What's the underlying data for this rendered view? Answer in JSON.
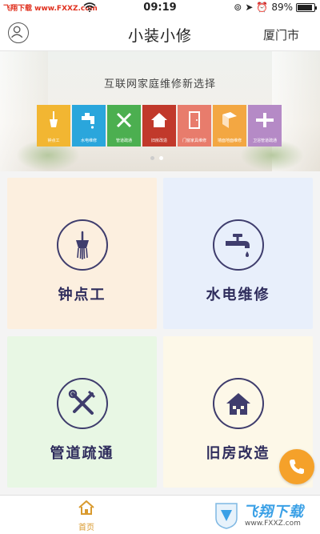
{
  "status_bar": {
    "carrier": "飞翔下载 www.FXXZ.com",
    "time": "09:19",
    "battery": "89%",
    "battery_level": 0.89
  },
  "nav": {
    "title": "小装小修",
    "city": "厦门市",
    "user_icon": "user-icon"
  },
  "banner": {
    "slogan": "互联网家庭维修新选择",
    "tiles": [
      {
        "label": "钟点工",
        "color": "#f2b632",
        "icon": "broom-icon"
      },
      {
        "label": "水电维修",
        "color": "#2aa6dc",
        "icon": "faucet-icon"
      },
      {
        "label": "管道疏通",
        "color": "#4caf50",
        "icon": "tools-icon"
      },
      {
        "label": "旧房改造",
        "color": "#c1392b",
        "icon": "house-icon"
      },
      {
        "label": "门窗家具维修",
        "color": "#e87c6c",
        "icon": "door-icon"
      },
      {
        "label": "墙面地面维修",
        "color": "#f3a742",
        "icon": "wall-icon"
      },
      {
        "label": "卫浴管道疏通",
        "color": "#b58ac6",
        "icon": "pipe-icon"
      }
    ],
    "active_dot": 1,
    "dot_count": 2
  },
  "services": [
    {
      "label": "钟点工",
      "icon": "broom-icon"
    },
    {
      "label": "水电维修",
      "icon": "faucet-icon"
    },
    {
      "label": "管道疏通",
      "icon": "tools-icon"
    },
    {
      "label": "旧房改造",
      "icon": "house-icon"
    }
  ],
  "fab": {
    "icon": "phone-icon"
  },
  "tabbar": {
    "home_label": "首页"
  },
  "watermark": {
    "brand": "飞翔下载",
    "url": "www.FXXZ.com"
  },
  "colors": {
    "accent": "#d99a2e",
    "service_ink": "#3f3d6d",
    "phone": "#f5a12a"
  }
}
